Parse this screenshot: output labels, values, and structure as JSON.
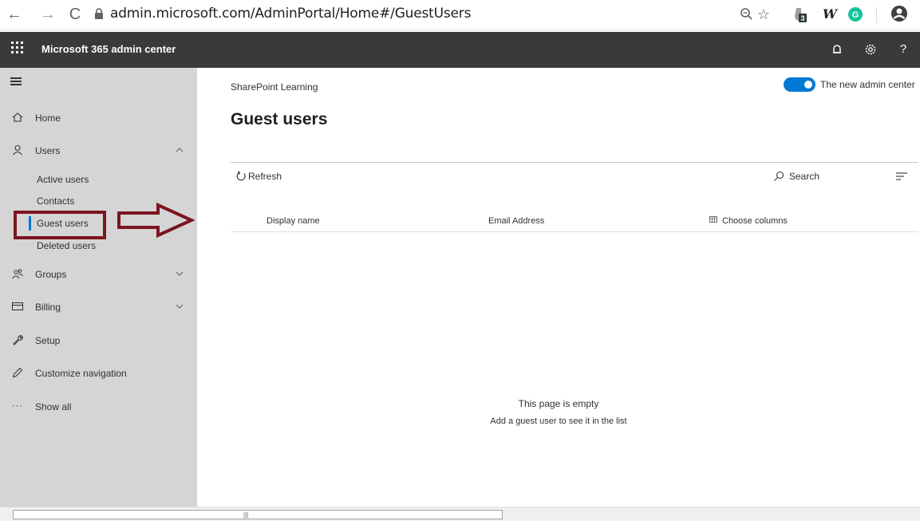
{
  "browser": {
    "url": "admin.microsoft.com/AdminPortal/Home#/GuestUsers",
    "extension_badge": "3",
    "extension_w": "W",
    "extension_g": "G"
  },
  "suite": {
    "title": "Microsoft 365 admin center",
    "help_label": "?"
  },
  "nav": {
    "home": "Home",
    "users": "Users",
    "users_sub": [
      "Active users",
      "Contacts",
      "Guest users",
      "Deleted users"
    ],
    "groups": "Groups",
    "billing": "Billing",
    "setup": "Setup",
    "customize": "Customize navigation",
    "show_all": "Show all",
    "selected": "Guest users"
  },
  "main": {
    "breadcrumb": "SharePoint Learning",
    "toggle_label": "The new admin center",
    "toggle_on": true,
    "title": "Guest users",
    "refresh_label": "Refresh",
    "search_label": "Search",
    "columns": [
      "Display name",
      "Email Address",
      "Choose columns"
    ],
    "empty_title": "This page is empty",
    "empty_subtitle": "Add a guest user to see it in the list"
  },
  "colors": {
    "suite_bar": "#3b3a39",
    "accent": "#0078d4",
    "annotation": "#7b1521",
    "nav_bg": "#d5d5d5"
  }
}
